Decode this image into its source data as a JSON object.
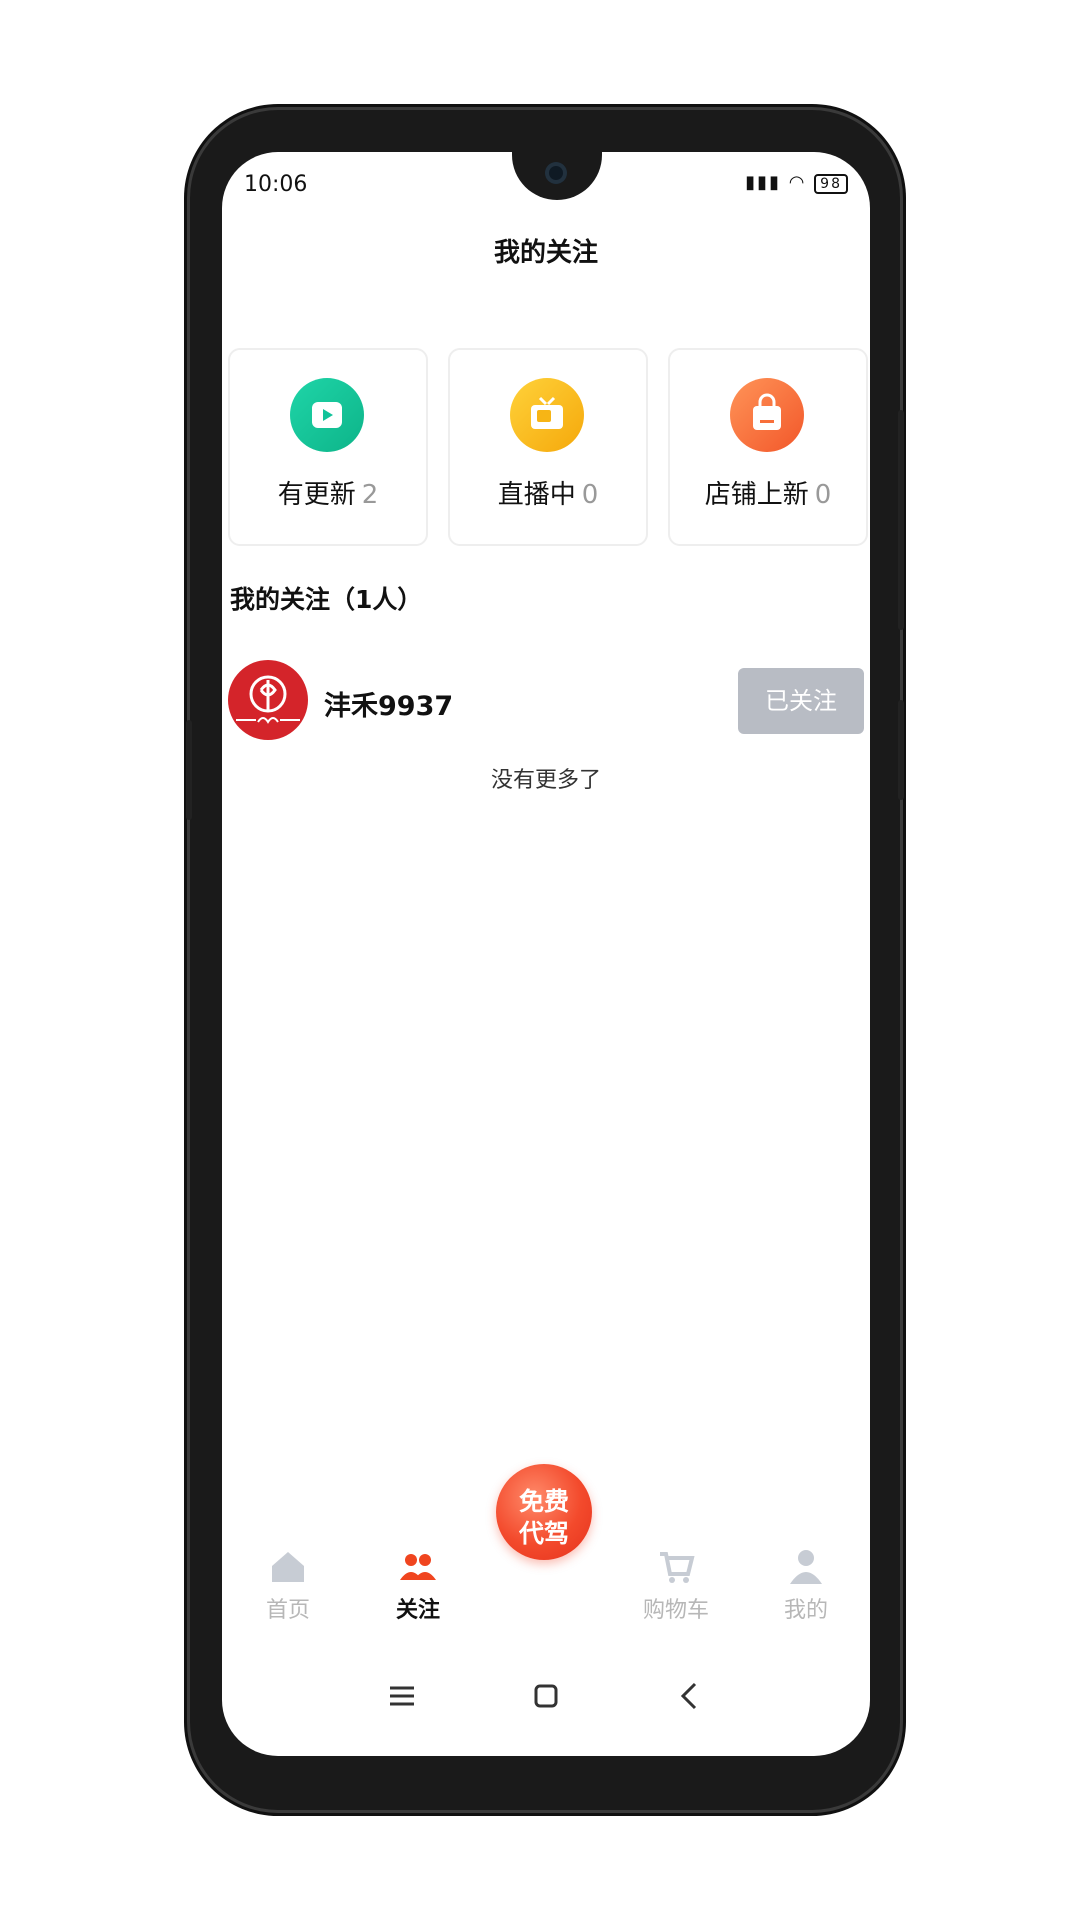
{
  "status_bar": {
    "time": "10:06",
    "battery": "98"
  },
  "header": {
    "title": "我的关注"
  },
  "cards": [
    {
      "label": "有更新",
      "count": "2",
      "color": "#12c39a"
    },
    {
      "label": "直播中",
      "count": "0",
      "color": "#f7b515"
    },
    {
      "label": "店铺上新",
      "count": "0",
      "color": "#f86f3a"
    }
  ],
  "section": {
    "title": "我的关注（1人）"
  },
  "follow_list": [
    {
      "name": "沣禾9937",
      "button": "已关注"
    }
  ],
  "list_footer": "没有更多了",
  "tabbar": {
    "items": [
      {
        "label": "首页",
        "icon": "home-icon",
        "active": false
      },
      {
        "label": "关注",
        "icon": "people-icon",
        "active": true
      },
      {
        "label": "免费代驾",
        "line1": "免费",
        "line2": "代驾",
        "icon": "center-action"
      },
      {
        "label": "购物车",
        "icon": "cart-icon",
        "active": false
      },
      {
        "label": "我的",
        "icon": "user-icon",
        "active": false
      }
    ],
    "accent_color": "#f0451f"
  }
}
